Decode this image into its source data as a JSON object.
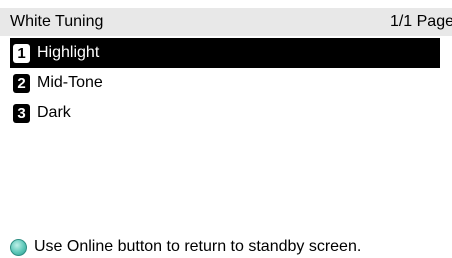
{
  "header": {
    "title": "White Tuning",
    "page_indicator": "1/1 Page"
  },
  "menu": {
    "items": [
      {
        "number": "1",
        "label": "Highlight",
        "selected": true
      },
      {
        "number": "2",
        "label": "Mid-Tone",
        "selected": false
      },
      {
        "number": "3",
        "label": "Dark",
        "selected": false
      }
    ]
  },
  "footer": {
    "icon": "online-button-icon",
    "message": "Use Online button to return to standby screen."
  },
  "colors": {
    "header_bg": "#e8e8e8",
    "selected_bg": "#000000",
    "online_icon": "#5cc7b8"
  }
}
